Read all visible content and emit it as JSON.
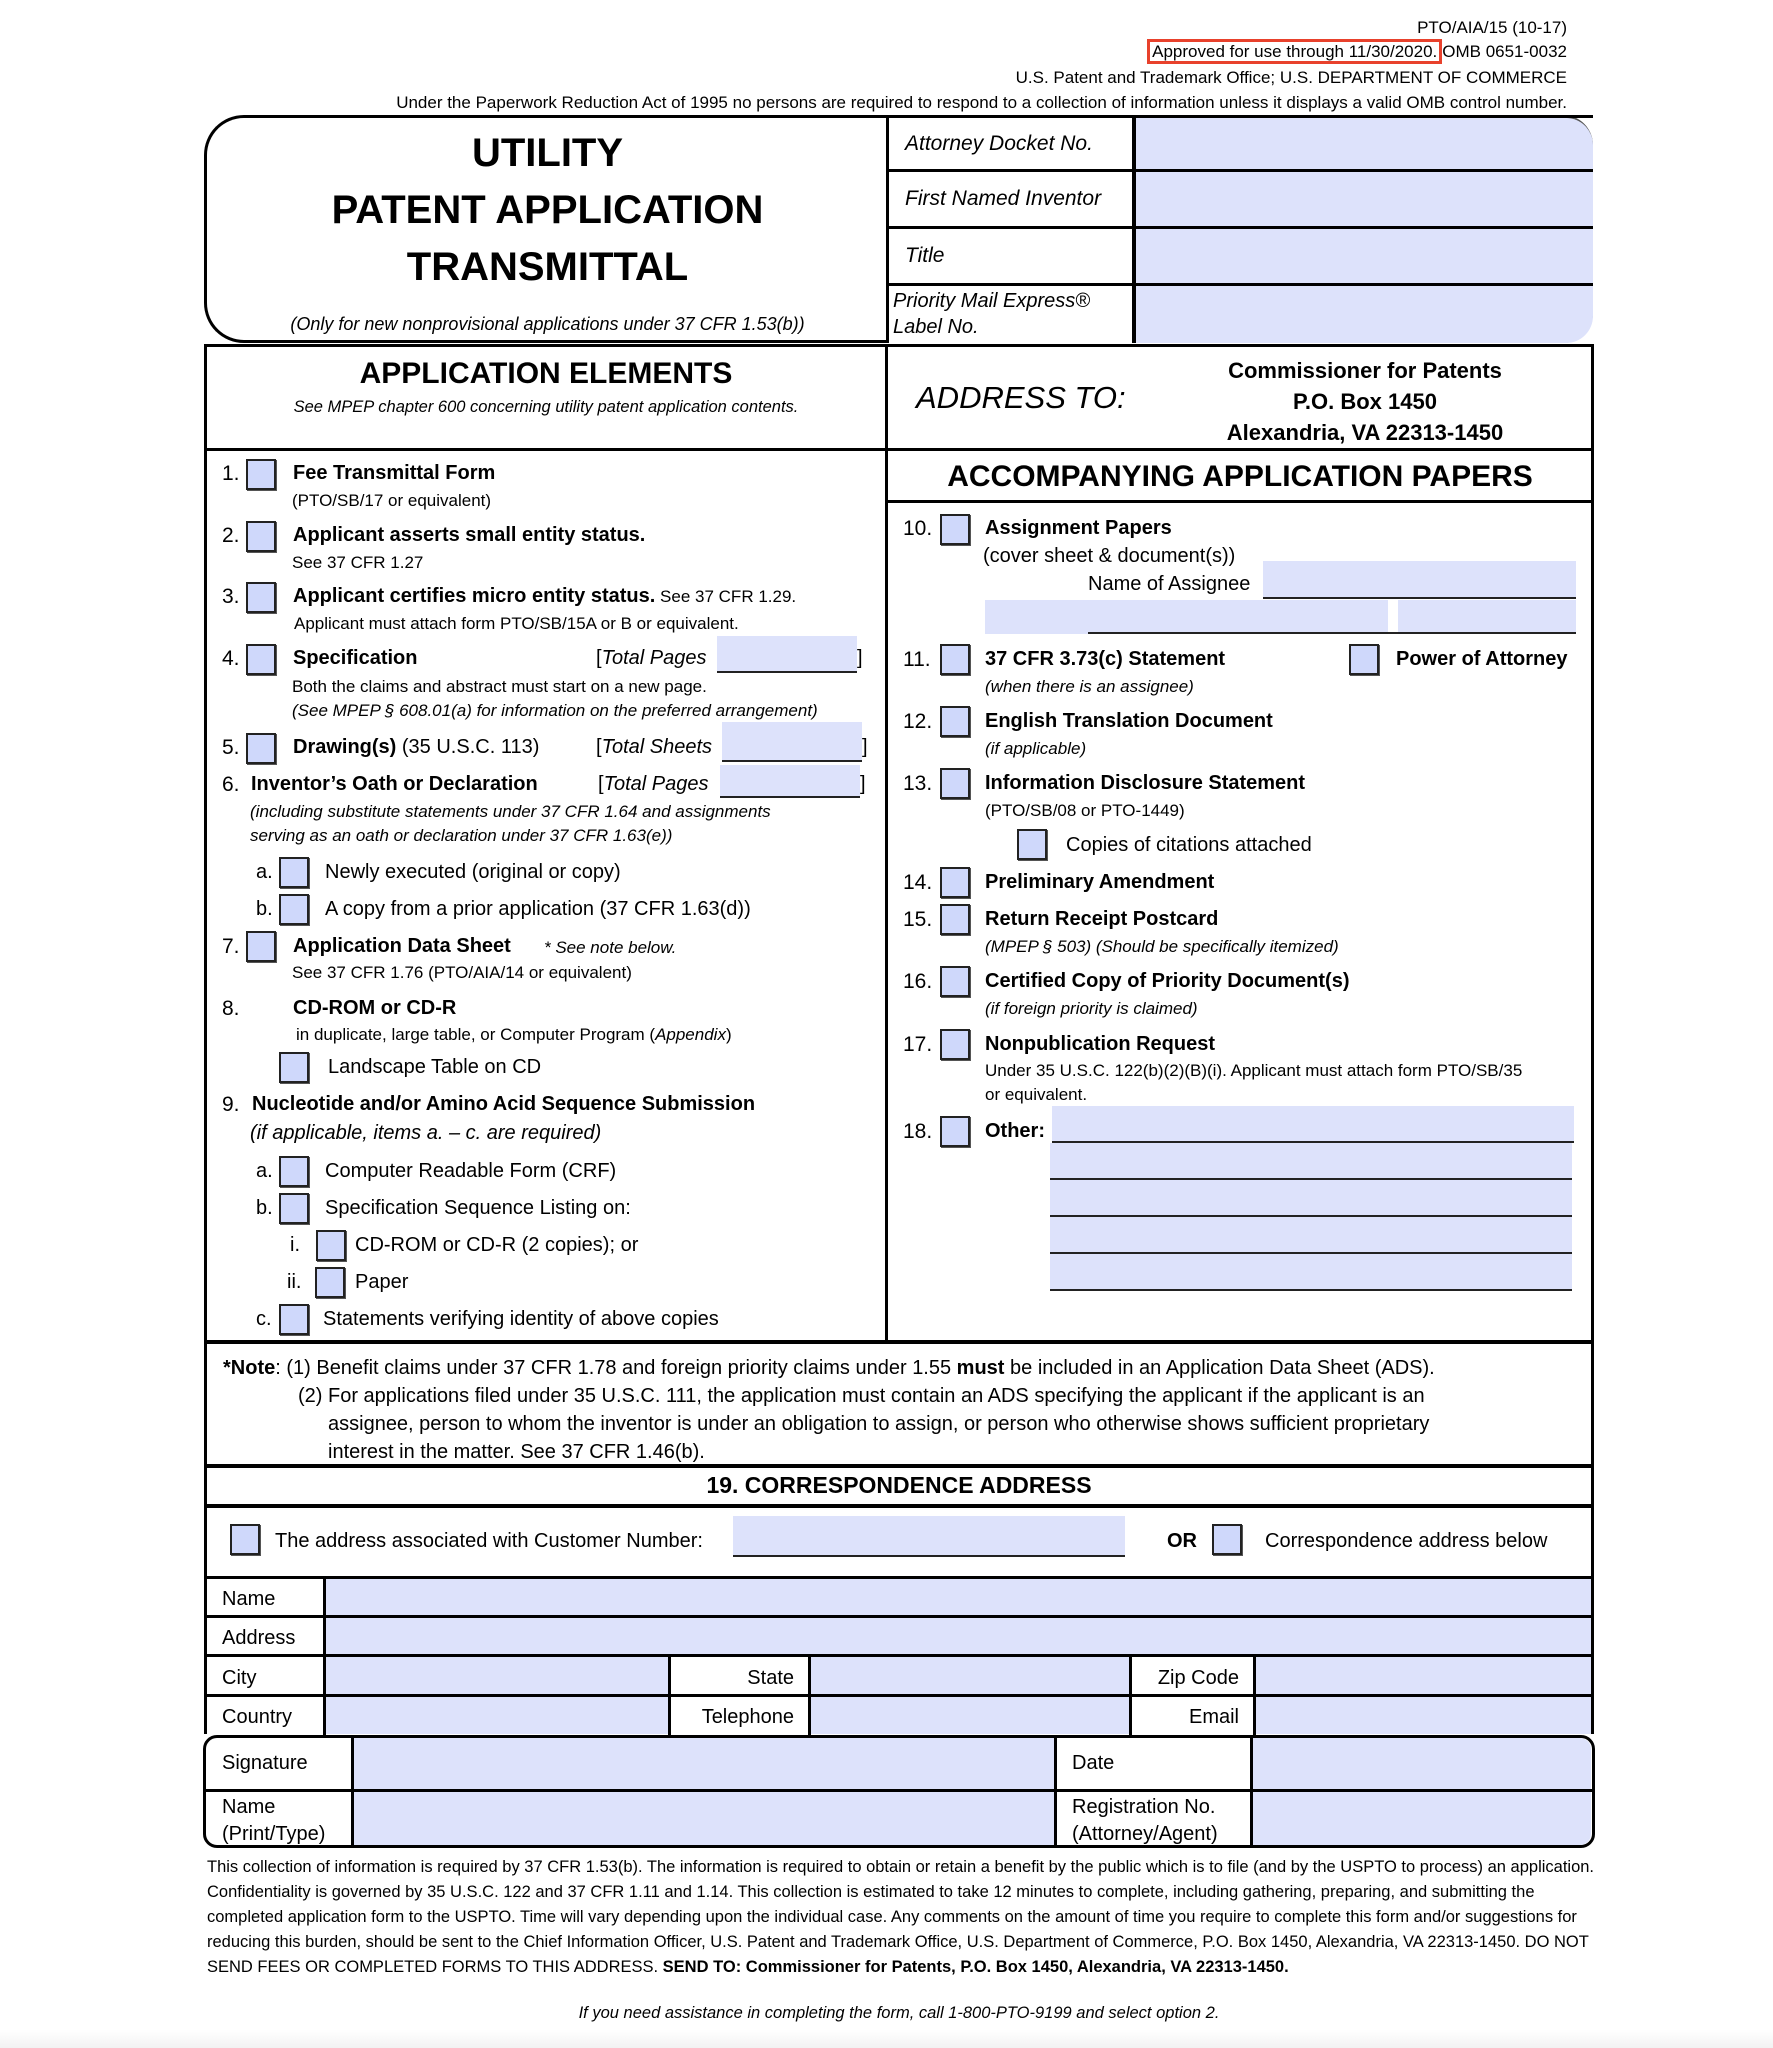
{
  "header": {
    "form_id": "PTO/AIA/15 (10-17)",
    "approved": "Approved for use through 11/30/2020.",
    "omb": "OMB 0651-0032",
    "agency": "U.S. Patent and Trademark Office; U.S. DEPARTMENT OF COMMERCE",
    "paperwork": "Under the Paperwork Reduction Act of 1995 no persons are required to respond to a collection of information unless it displays a valid OMB control number.",
    "highlight_color": "#e8412c"
  },
  "title": {
    "line1": "UTILITY",
    "line2": "PATENT APPLICATION",
    "line3": "TRANSMITTAL",
    "subtitle": "(Only for new nonprovisional applications under 37 CFR 1.53(b))"
  },
  "top_fields": [
    {
      "label": "Attorney Docket No.",
      "value": ""
    },
    {
      "label": "First Named Inventor",
      "value": ""
    },
    {
      "label": "Title",
      "value": ""
    },
    {
      "label": "Priority Mail Express® Label No.",
      "value": ""
    }
  ],
  "application_elements": {
    "title": "APPLICATION ELEMENTS",
    "subtitle": "See MPEP chapter 600 concerning utility patent application contents.",
    "items": [
      {
        "num": "1.",
        "label": "Fee Transmittal Form",
        "sub": "(PTO/SB/17 or equivalent)"
      },
      {
        "num": "2.",
        "label": "Applicant asserts small entity status.",
        "sub": "See 37 CFR 1.27"
      },
      {
        "num": "3.",
        "label": "Applicant certifies micro entity status.",
        "label_suffix": " See 37 CFR 1.29.",
        "sub": "Applicant must attach form PTO/SB/15A or B or equivalent."
      },
      {
        "num": "4.",
        "label": "Specification",
        "count_label": "Total Pages",
        "sub": "Both the claims and abstract must start on a new page.",
        "sub2": "(See MPEP § 608.01(a) for information on the preferred arrangement)"
      },
      {
        "num": "5.",
        "label": "Drawing(s)",
        "label_suffix": " (35 U.S.C. 113)",
        "count_label": "Total Sheets"
      },
      {
        "num": "6.",
        "label": "Inventor’s Oath or Declaration",
        "count_label": "Total Pages",
        "sub": "(including substitute statements under 37 CFR 1.64 and assignments",
        "sub2": "serving as an oath or declaration under 37 CFR 1.63(e))",
        "options": [
          {
            "letter": "a.",
            "label": "Newly executed (original or copy)"
          },
          {
            "letter": "b.",
            "label": "A copy from a prior application (37 CFR 1.63(d))"
          }
        ]
      },
      {
        "num": "7.",
        "label": "Application Data Sheet",
        "note": "* See note below.",
        "sub": "See 37 CFR 1.76 (PTO/AIA/14 or equivalent)"
      },
      {
        "num": "8.",
        "label": "CD-ROM or CD-R",
        "sub": "in duplicate, large table, or Computer Program (",
        "sub_ital": "Appendix",
        "sub_end": ")",
        "option": "Landscape Table on CD"
      },
      {
        "num": "9.",
        "label": "Nucleotide and/or Amino Acid Sequence Submission",
        "sub": "(if applicable, items a. – c. are required)",
        "options": [
          {
            "letter": "a.",
            "label": "Computer Readable Form (CRF)"
          },
          {
            "letter": "b.",
            "label": "Specification Sequence Listing on:"
          },
          {
            "letter": "i.",
            "label": "CD-ROM or CD-R (2 copies); or"
          },
          {
            "letter": "ii.",
            "label": "Paper"
          },
          {
            "letter": "c.",
            "label": "Statements verifying identity of above copies"
          }
        ]
      }
    ]
  },
  "address_to": {
    "label": "ADDRESS TO:",
    "line1": "Commissioner for Patents",
    "line2": "P.O. Box 1450",
    "line3": "Alexandria, VA  22313-1450"
  },
  "accompanying": {
    "title": "ACCOMPANYING APPLICATION PAPERS",
    "items": [
      {
        "num": "10.",
        "label": "Assignment Papers",
        "sub": "(cover sheet & document(s))",
        "assignee_label": "Name of Assignee"
      },
      {
        "num": "11.",
        "label": "37 CFR 3.73(c) Statement",
        "sub": "(when there is an assignee)",
        "extra": "Power of Attorney"
      },
      {
        "num": "12.",
        "label": "English Translation Document",
        "sub": "(if applicable)"
      },
      {
        "num": "13.",
        "label": "Information Disclosure Statement",
        "sub": "(PTO/SB/08 or PTO-1449)",
        "option": "Copies of citations attached"
      },
      {
        "num": "14.",
        "label": "Preliminary Amendment"
      },
      {
        "num": "15.",
        "label": "Return Receipt Postcard",
        "sub": "(MPEP § 503) (Should be specifically itemized)"
      },
      {
        "num": "16.",
        "label": "Certified Copy of Priority Document(s)",
        "sub": "(if foreign priority is claimed)"
      },
      {
        "num": "17.",
        "label": "Nonpublication Request",
        "sub": "Under 35 U.S.C. 122(b)(2)(B)(i). Applicant must attach form PTO/SB/35",
        "sub2": "or equivalent."
      },
      {
        "num": "18.",
        "label": "Other:"
      }
    ]
  },
  "note": {
    "lead": "*Note",
    "p1_a": ":  (1) Benefit claims under 37 CFR 1.78 and foreign priority claims under 1.55 ",
    "p1_bold": "must",
    "p1_b": " be included in an Application Data Sheet (ADS).",
    "p2_line1": "(2) For applications filed under 35 U.S.C. 111, the application must contain an ADS specifying the applicant if the applicant is an",
    "p2_line2": "assignee, person to whom the inventor is under an obligation to assign, or person who otherwise shows sufficient proprietary",
    "p2_line3": "interest in the matter. See 37 CFR 1.46(b)."
  },
  "correspondence": {
    "title": "19. CORRESPONDENCE ADDRESS",
    "customer_label": "The address associated with Customer Number:",
    "or": "OR",
    "below_label": "Correspondence address below",
    "fields": {
      "name": "Name",
      "address": "Address",
      "city": "City",
      "state": "State",
      "zip": "Zip Code",
      "country": "Country",
      "telephone": "Telephone",
      "email": "Email"
    }
  },
  "signature": {
    "signature": "Signature",
    "date": "Date",
    "name_line1": "Name",
    "name_line2": "(Print/Type)",
    "reg_line1": "Registration No.",
    "reg_line2": "(Attorney/Agent)"
  },
  "footer": {
    "burden": "This collection of information is required by 37 CFR 1.53(b). The information is required to obtain or retain a benefit by the public which is to file (and by the USPTO to process) an application. Confidentiality is governed by 35 U.S.C. 122 and 37 CFR 1.11 and 1.14. This collection is estimated to take 12 minutes to complete, including gathering, preparing, and submitting the completed application form to the USPTO. Time will vary depending upon the individual case. Any comments on the amount of time you require to complete this form and/or suggestions for reducing this burden, should be sent to the Chief Information Officer, U.S. Patent and Trademark Office, U.S. Department of Commerce, P.O. Box 1450, Alexandria, VA 22313-1450. DO NOT SEND FEES OR COMPLETED FORMS TO THIS ADDRESS. ",
    "send_to": "SEND TO: Commissioner for Patents, P.O. Box 1450, Alexandria, VA 22313-1450.",
    "assistance": "If you need assistance in completing the form, call 1-800-PTO-9199 and select option 2."
  }
}
